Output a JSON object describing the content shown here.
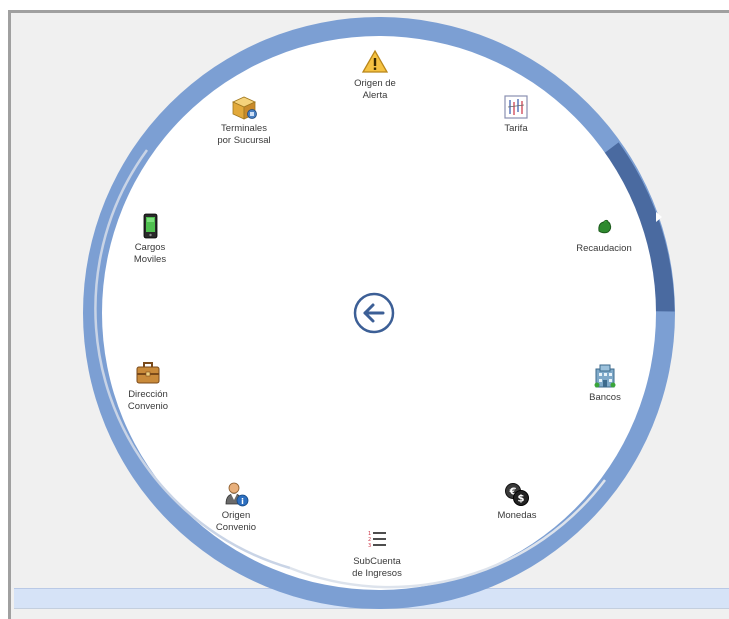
{
  "radial_menu": {
    "items": [
      {
        "label": "Origen de\nAlerta",
        "icon": "warning-icon"
      },
      {
        "label": "Tarifa",
        "icon": "tariff-chart-icon"
      },
      {
        "label": "Recaudacion",
        "icon": "money-icon"
      },
      {
        "label": "Bancos",
        "icon": "bank-building-icon"
      },
      {
        "label": "Monedas",
        "icon": "currency-coins-icon"
      },
      {
        "label": "SubCuenta\nde Ingresos",
        "icon": "numbered-list-icon"
      },
      {
        "label": "Origen\nConvenio",
        "icon": "user-info-icon"
      },
      {
        "label": "Dirección\nConvenio",
        "icon": "briefcase-icon"
      },
      {
        "label": "Cargos\nMoviles",
        "icon": "mobile-phone-icon"
      },
      {
        "label": "Terminales\npor Sucursal",
        "icon": "box-terminal-icon"
      }
    ],
    "back_icon": "back-arrow-icon",
    "navigation_icon": "chevron-right-icon"
  },
  "colors": {
    "ring": "#7c9fd3",
    "ring_active_segment": "#4a6aa0",
    "inner_arc": "#c9d4e6",
    "back_button": "#3c5f96",
    "label": "#3a3a3a",
    "bottom_band": "#d6e3f7"
  }
}
